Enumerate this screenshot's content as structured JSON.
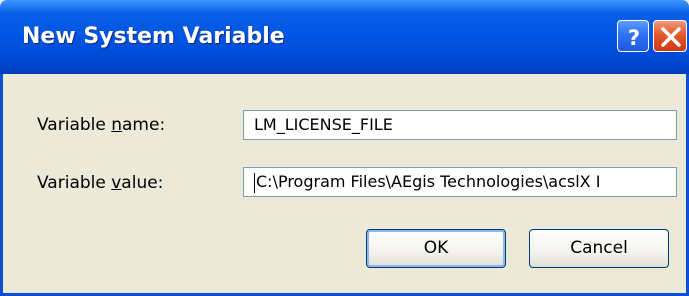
{
  "window": {
    "title": "New System Variable"
  },
  "icons": {
    "help": "help-icon",
    "close": "close-icon"
  },
  "form": {
    "name_label_pre": "Variable ",
    "name_label_u": "n",
    "name_label_post": "ame:",
    "name_value": "LM_LICENSE_FILE",
    "value_label_pre": "Variable ",
    "value_label_u": "v",
    "value_label_post": "alue:",
    "value_value": "C:\\Program Files\\AEgis Technologies\\acslX I"
  },
  "buttons": {
    "ok": "OK",
    "cancel": "Cancel"
  },
  "colors": {
    "titlebar": "#0055e3",
    "dialog_bg": "#ece9d8",
    "close_button": "#e3592e",
    "help_button": "#2f73f0"
  }
}
